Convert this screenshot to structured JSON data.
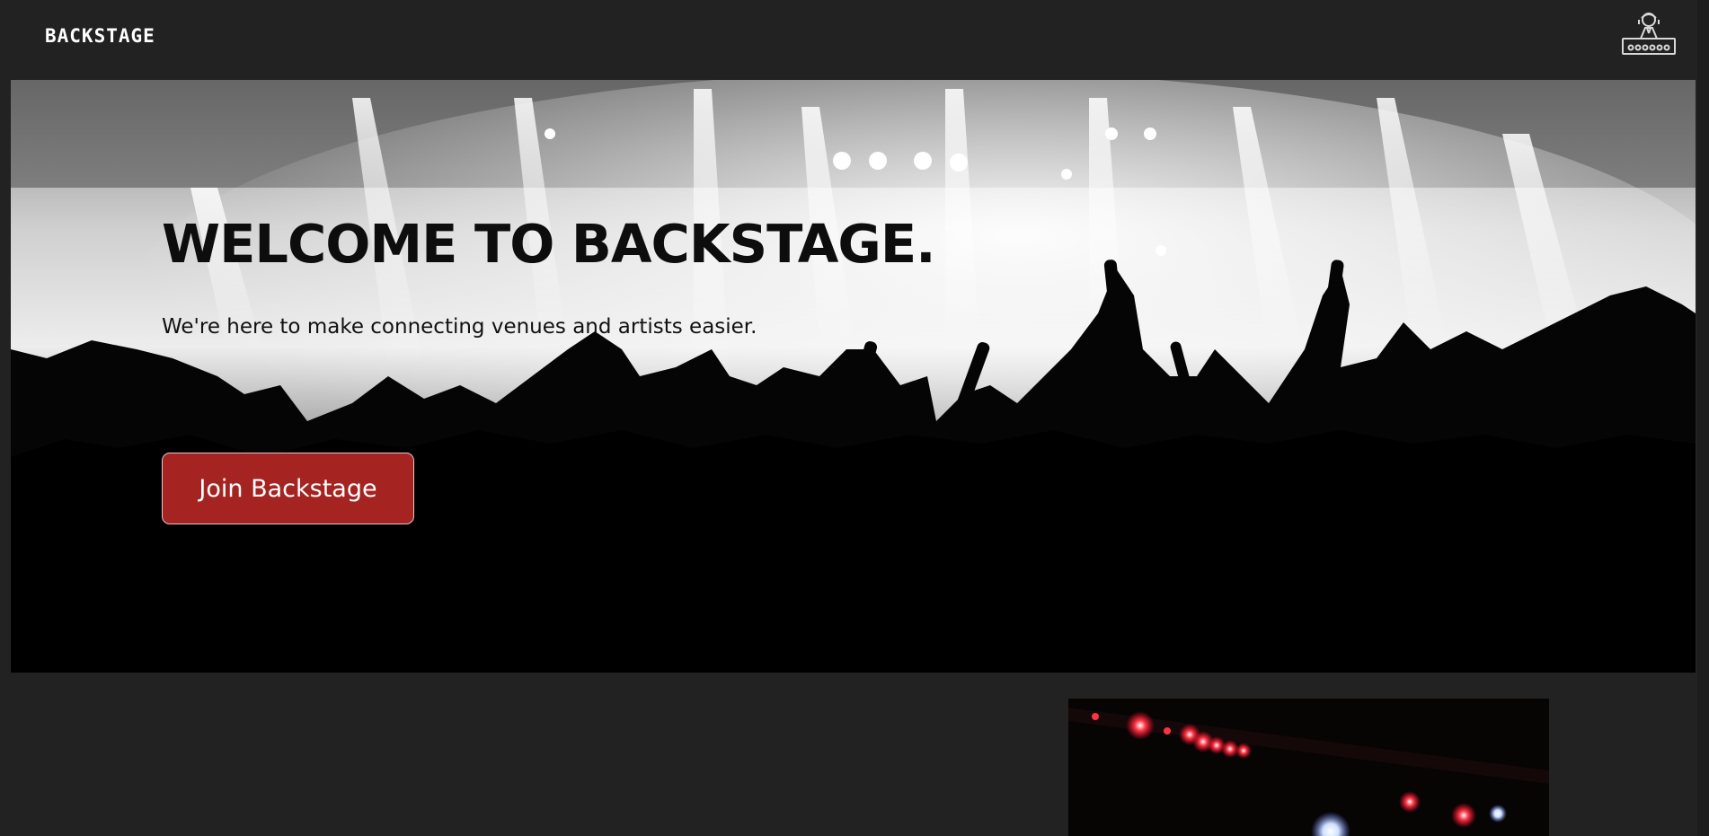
{
  "nav": {
    "brand": "BACKSTAGE",
    "logo_icon": "dj-turntable-icon"
  },
  "hero": {
    "title": "WELCOME TO BACKSTAGE.",
    "subtitle": "We're here to make connecting venues and artists easier.",
    "cta_label": "Join Backstage",
    "cta_color": "#a52321",
    "background": "concert-crowd-photo"
  },
  "section": {
    "photo": "concert-stage-lights-photo"
  },
  "colors": {
    "page_bg": "#222222",
    "accent": "#a52321",
    "text_on_dark": "#ffffff"
  }
}
